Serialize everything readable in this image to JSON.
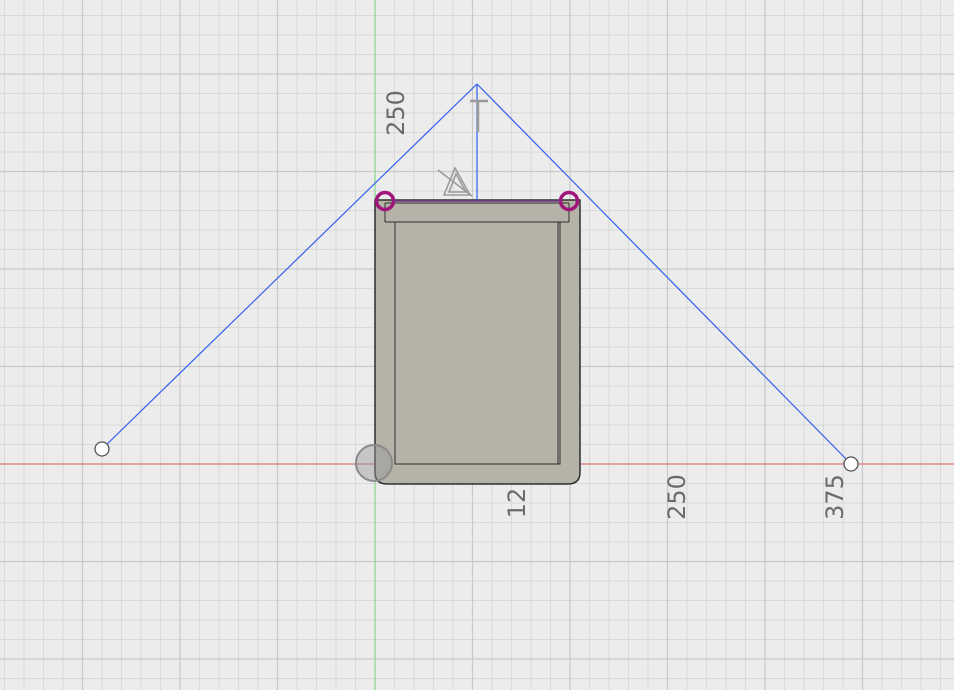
{
  "viewport": {
    "background_color": "#ececec",
    "minor_grid_color": "#d9d9d9",
    "major_grid_color": "#c9c9c9",
    "x_axis_color": "#e06060",
    "y_axis_color": "#7dd87d"
  },
  "sketch": {
    "line_color": "#2f5ff0",
    "body_fill_color": "#b5b2a8",
    "body_edge_color": "#2e2e2e",
    "selected_point_color": "#a0157a",
    "sketch_point_icon": "circle-point-icon",
    "constraint_icons": [
      "perpendicular-constraint-icon",
      "equal-constraint-icon"
    ]
  },
  "dimension_labels": {
    "y_250": "250",
    "x_12": "12",
    "x_250": "250",
    "x_375": "375"
  }
}
